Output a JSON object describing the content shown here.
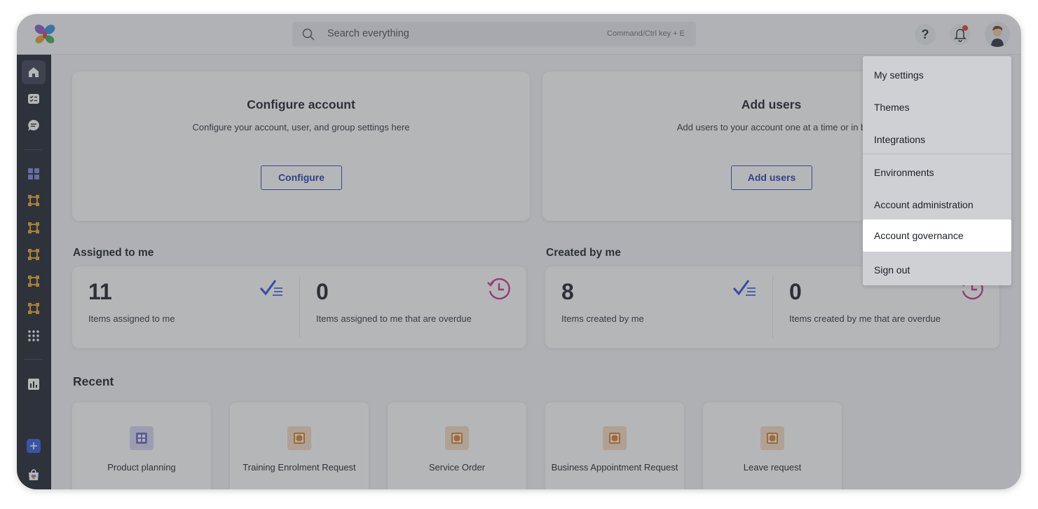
{
  "search": {
    "placeholder": "Search everything",
    "shortcut_hint": "Command/Ctrl key + E"
  },
  "topbar": {
    "help_glyph": "?",
    "icons": [
      "logo-icon",
      "search-icon",
      "help-icon",
      "bell-icon",
      "avatar"
    ]
  },
  "sidebar": {
    "items": [
      {
        "name": "home-icon"
      },
      {
        "name": "tasks-icon"
      },
      {
        "name": "chat-icon"
      },
      {
        "name": "dashboard-icon"
      },
      {
        "name": "app-icon"
      },
      {
        "name": "app-icon"
      },
      {
        "name": "app-icon"
      },
      {
        "name": "app-icon"
      },
      {
        "name": "app-icon"
      },
      {
        "name": "apps-grid-icon"
      },
      {
        "name": "reports-icon"
      },
      {
        "name": "add-icon"
      },
      {
        "name": "marketplace-icon"
      }
    ]
  },
  "cards": {
    "configure": {
      "title": "Configure account",
      "subtitle": "Configure your account, user, and group settings here",
      "button": "Configure"
    },
    "add_users": {
      "title": "Add users",
      "subtitle": "Add users to your account one at a time or in b",
      "button": "Add users"
    }
  },
  "assigned": {
    "heading": "Assigned to me",
    "items": {
      "value": "11",
      "label": "Items assigned to me"
    },
    "overdue": {
      "value": "0",
      "label": "Items assigned to me that are overdue"
    }
  },
  "created": {
    "heading": "Created by me",
    "items": {
      "value": "8",
      "label": "Items created by me"
    },
    "overdue": {
      "value": "0",
      "label": "Items created by me that are overdue"
    }
  },
  "recent": {
    "heading": "Recent",
    "items": [
      {
        "label": "Product planning",
        "color": "#6b6fc8"
      },
      {
        "label": "Training Enrolment Request",
        "color": "#d9822b"
      },
      {
        "label": "Service Order",
        "color": "#d9822b"
      },
      {
        "label": "Business Appointment Request",
        "color": "#d9822b"
      },
      {
        "label": "Leave request",
        "color": "#d9822b"
      }
    ]
  },
  "menu": {
    "items": [
      "My settings",
      "Themes",
      "Integrations",
      "Environments",
      "Account administration",
      "Account governance",
      "Sign out"
    ],
    "highlighted": "Account governance"
  },
  "colors": {
    "accent": "#2340b0",
    "sidebar": "#1f2430",
    "check": "#2d4fd8",
    "history": "#c0398f",
    "app": "#e6a52a"
  }
}
